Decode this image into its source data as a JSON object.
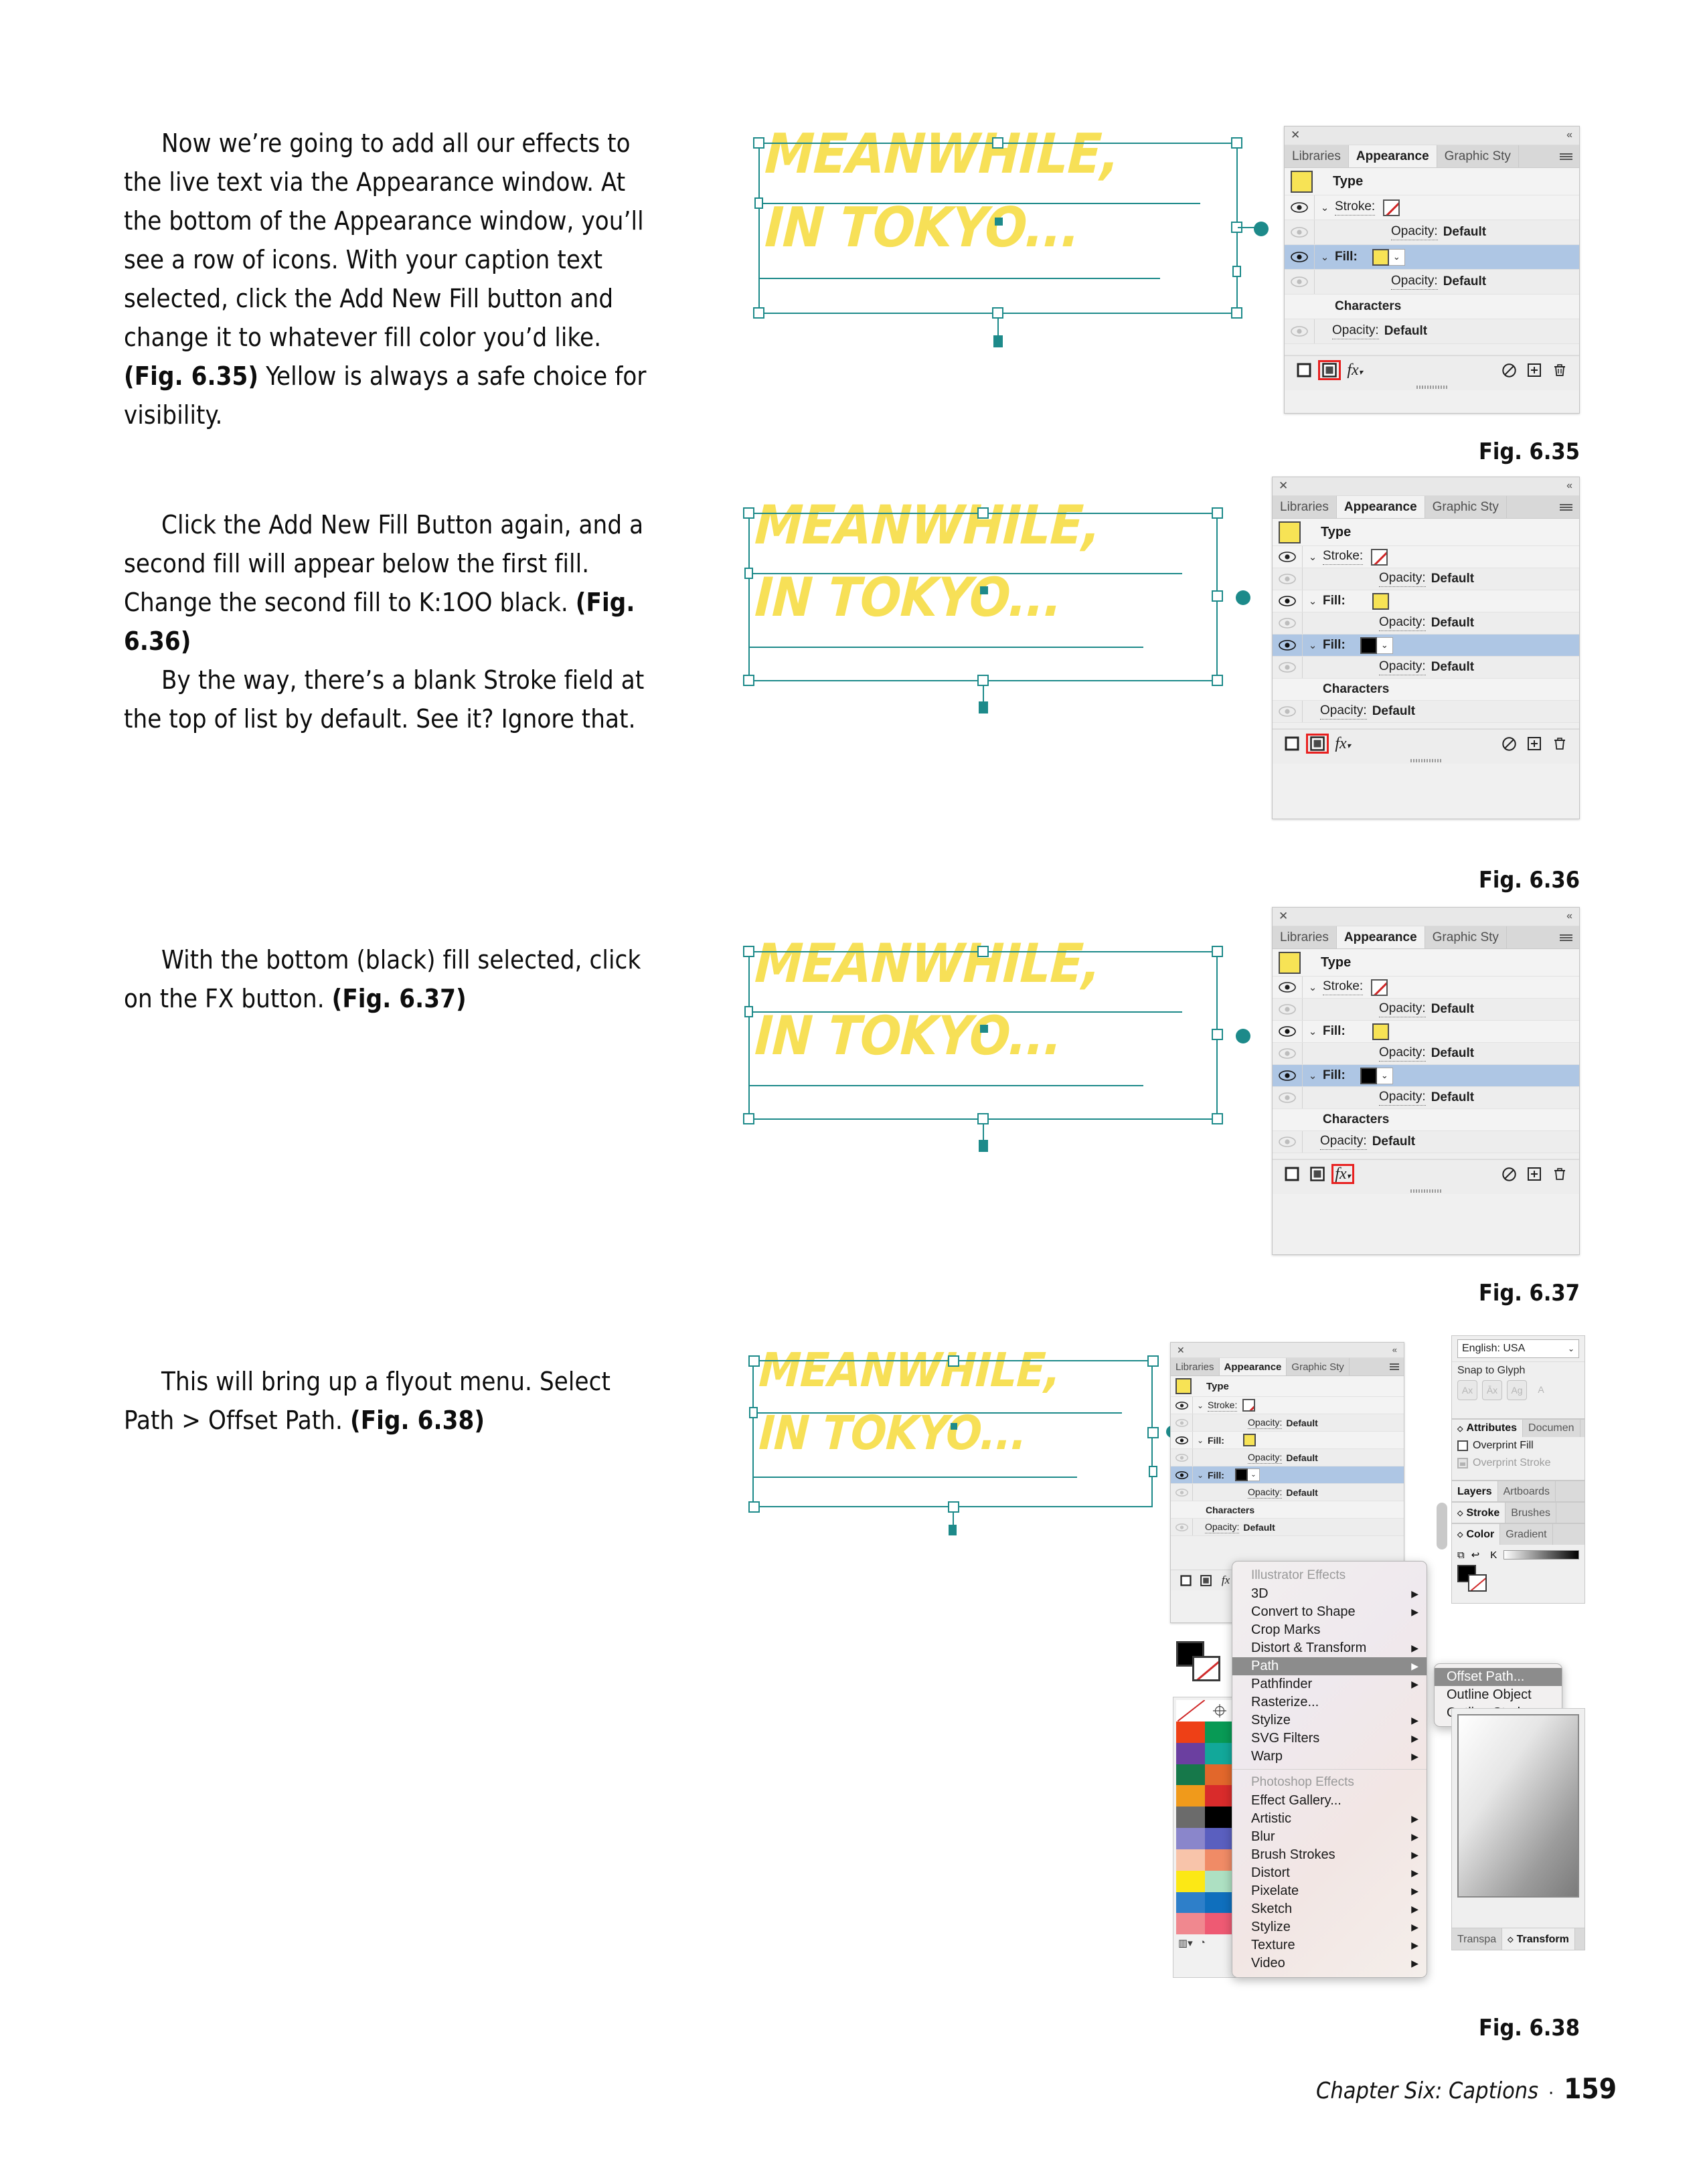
{
  "document": {
    "footer_chapter": "Chapter Six: Captions",
    "footer_separator": "·",
    "page_number": "159"
  },
  "body": {
    "paragraphs": [
      "Now we’re going to add all our effects to the live text via the Appearance window. At the bottom of the Appearance window, you’ll see a row of icons. With your caption text selected, click the Add New Fill button and change it to whatever fill color you’d like.",
      "Click the Add New Fill Button again, and a second fill will appear below the first fill. Change the second fill to K:1OO black.",
      "By the way, there’s a blank Stroke field at the top of list by default. See it? Ignore that.",
      "With the bottom (black) fill selected, click on the FX button.",
      "This will bring up a flyout menu. Select Path > Offset Path."
    ],
    "refs": {
      "r35": "(Fig. 6.35)",
      "r36": "(Fig. 6.36)",
      "r37": "(Fig. 6.37)",
      "r38": "(Fig. 6.38)"
    },
    "tails": {
      "t1": " Yellow is always a safe choice for visibility."
    }
  },
  "artwork": {
    "line1": "MEANWHILE,",
    "line2": "IN TOKYO...",
    "fill_color": "#F7E057",
    "selection_color": "#1d8a8a"
  },
  "figures": [
    {
      "caption": "Fig. 6.35"
    },
    {
      "caption": "Fig. 6.36"
    },
    {
      "caption": "Fig. 6.37"
    },
    {
      "caption": "Fig. 6.38"
    }
  ],
  "appearance_panel": {
    "tabs": [
      {
        "label": "Libraries",
        "active": false
      },
      {
        "label": "Appearance",
        "active": true
      },
      {
        "label": "Graphic Sty",
        "active": false
      }
    ],
    "menu_icon": "hamburger-icon",
    "close_icon": "close-icon",
    "collapse_icon": "collapse-chevrons-icon",
    "type_label": "Type",
    "type_swatch_color": "#F7E355",
    "labels": {
      "stroke": "Stroke:",
      "fill": "Fill:",
      "opacity": "Opacity:",
      "opacity_value": "Default",
      "characters": "Characters"
    },
    "footer_buttons": [
      {
        "name": "add-new-stroke-button",
        "icon": "square-outline-icon"
      },
      {
        "name": "add-new-fill-button",
        "icon": "square-filled-icon"
      },
      {
        "name": "add-new-effect-button",
        "icon": "fx-icon"
      },
      {
        "name": "clear-appearance-button",
        "icon": "no-entry-icon"
      },
      {
        "name": "duplicate-item-button",
        "icon": "plus-box-icon"
      },
      {
        "name": "delete-item-button",
        "icon": "trash-icon"
      }
    ]
  },
  "fig635": {
    "rows": [
      {
        "type": "stroke",
        "label": "Stroke:",
        "swatch": "none",
        "eye": true,
        "selected": false
      },
      {
        "type": "opacity",
        "label": "Opacity:",
        "value": "Default",
        "eye_dim": true
      },
      {
        "type": "fill",
        "label": "Fill:",
        "swatch": "#F7E355",
        "dropdown": true,
        "eye": true,
        "selected": true
      },
      {
        "type": "opacity",
        "label": "Opacity:",
        "value": "Default",
        "eye_dim": true
      },
      {
        "type": "characters",
        "label": "Characters"
      },
      {
        "type": "opacity",
        "label": "Opacity:",
        "value": "Default",
        "eye_dim": true
      }
    ],
    "highlight": "add-new-fill-button"
  },
  "fig636": {
    "rows": [
      {
        "type": "stroke",
        "label": "Stroke:",
        "swatch": "none",
        "eye": true,
        "selected": false
      },
      {
        "type": "opacity",
        "label": "Opacity:",
        "value": "Default",
        "eye_dim": true
      },
      {
        "type": "fill",
        "label": "Fill:",
        "swatch": "#F7E355",
        "dropdown": false,
        "eye": true,
        "selected": false
      },
      {
        "type": "opacity",
        "label": "Opacity:",
        "value": "Default",
        "eye_dim": true
      },
      {
        "type": "fill",
        "label": "Fill:",
        "swatch": "#000000",
        "dropdown": true,
        "eye": true,
        "selected": true
      },
      {
        "type": "opacity",
        "label": "Opacity:",
        "value": "Default",
        "eye_dim": true
      },
      {
        "type": "characters",
        "label": "Characters"
      },
      {
        "type": "opacity",
        "label": "Opacity:",
        "value": "Default",
        "eye_dim": true
      }
    ],
    "highlight": "add-new-fill-button"
  },
  "fig637": {
    "rows": [
      {
        "type": "stroke",
        "label": "Stroke:",
        "swatch": "none",
        "eye": true,
        "selected": false
      },
      {
        "type": "opacity",
        "label": "Opacity:",
        "value": "Default",
        "eye_dim": true
      },
      {
        "type": "fill",
        "label": "Fill:",
        "swatch": "#F7E355",
        "dropdown": false,
        "eye": true,
        "selected": false
      },
      {
        "type": "opacity",
        "label": "Opacity:",
        "value": "Default",
        "eye_dim": true
      },
      {
        "type": "fill",
        "label": "Fill:",
        "swatch": "#000000",
        "dropdown": true,
        "eye": true,
        "selected": true
      },
      {
        "type": "opacity",
        "label": "Opacity:",
        "value": "Default",
        "eye_dim": true
      },
      {
        "type": "characters",
        "label": "Characters"
      },
      {
        "type": "opacity",
        "label": "Opacity:",
        "value": "Default",
        "eye_dim": true
      }
    ],
    "highlight": "add-new-effect-button"
  },
  "fig638": {
    "flyout": {
      "section1_header": "Illustrator Effects",
      "section1_items": [
        {
          "label": "3D",
          "submenu": true
        },
        {
          "label": "Convert to Shape",
          "submenu": true
        },
        {
          "label": "Crop Marks",
          "submenu": false
        },
        {
          "label": "Distort & Transform",
          "submenu": true
        },
        {
          "label": "Path",
          "submenu": true,
          "selected": true
        },
        {
          "label": "Pathfinder",
          "submenu": true
        },
        {
          "label": "Rasterize...",
          "submenu": false
        },
        {
          "label": "Stylize",
          "submenu": true
        },
        {
          "label": "SVG Filters",
          "submenu": true
        },
        {
          "label": "Warp",
          "submenu": true
        }
      ],
      "section2_header": "Photoshop Effects",
      "section2_items": [
        {
          "label": "Effect Gallery...",
          "submenu": false
        },
        {
          "label": "Artistic",
          "submenu": true
        },
        {
          "label": "Blur",
          "submenu": true
        },
        {
          "label": "Brush Strokes",
          "submenu": true
        },
        {
          "label": "Distort",
          "submenu": true
        },
        {
          "label": "Pixelate",
          "submenu": true
        },
        {
          "label": "Sketch",
          "submenu": true
        },
        {
          "label": "Stylize",
          "submenu": true
        },
        {
          "label": "Texture",
          "submenu": true
        },
        {
          "label": "Video",
          "submenu": true
        }
      ]
    },
    "submenu": {
      "items": [
        {
          "label": "Offset Path...",
          "selected": true
        },
        {
          "label": "Outline Object",
          "selected": false
        },
        {
          "label": "Outline Stroke",
          "selected": false
        }
      ]
    },
    "right_stack": {
      "language_value": "English: USA",
      "snap_to_glyph_label": "Snap to Glyph",
      "snap_buttons": [
        "Ax",
        "Ax",
        "Ag",
        "A"
      ],
      "attributes_tabs": [
        {
          "label": "Attributes",
          "active": true
        },
        {
          "label": "Documen",
          "active": false
        }
      ],
      "overprint_fill": "Overprint Fill",
      "overprint_stroke": "Overprint Stroke",
      "layers_tabs": [
        {
          "label": "Layers",
          "active": true
        },
        {
          "label": "Artboards",
          "active": false
        }
      ],
      "stroke_tabs": [
        {
          "label": "Stroke",
          "active": true
        },
        {
          "label": "Brushes",
          "active": false
        }
      ],
      "color_tabs": [
        {
          "label": "Color",
          "active": true
        },
        {
          "label": "Gradient",
          "active": false
        }
      ],
      "color_channel": "K",
      "bottom_tabs": [
        {
          "label": "Transpa",
          "active": false
        },
        {
          "label": "Transform",
          "active": true
        }
      ]
    },
    "swatches": {
      "colors": [
        "none",
        "registration",
        "#EE4016",
        "#089A55",
        "#6B3FA0",
        "#12A89A",
        "#16784A",
        "#E2672B",
        "#F09A1B",
        "#D92B2B",
        "#6B6B6B",
        "#000000",
        "#8A86CB",
        "#5A5FBF",
        "#F8C4AA",
        "#F08B66",
        "#FCE815",
        "#ADE0C2",
        "#2E7FC9",
        "#0F6FBD",
        "#F0888F",
        "#EE5A73"
      ],
      "toolbar_icons": [
        "swatch-libraries-icon",
        "show-swatch-kinds-icon"
      ]
    }
  }
}
